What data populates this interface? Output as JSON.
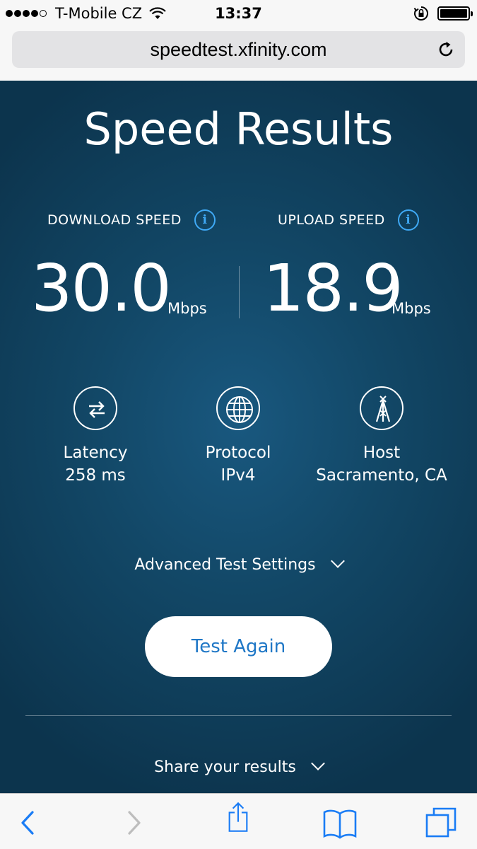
{
  "status_bar": {
    "carrier": "T-Mobile CZ",
    "time": "13:37",
    "signal_bars_filled": 4,
    "signal_bars_total": 5,
    "icons": [
      "wifi-icon",
      "orientation-lock-icon",
      "battery-icon"
    ]
  },
  "browser": {
    "url": "speedtest.xfinity.com",
    "reload_icon": "reload-icon"
  },
  "page": {
    "title": "Speed Results",
    "download": {
      "label": "DOWNLOAD SPEED",
      "value": "30.0",
      "unit": "Mbps",
      "info_glyph": "i"
    },
    "upload": {
      "label": "UPLOAD SPEED",
      "value": "18.9",
      "unit": "Mbps",
      "info_glyph": "i"
    },
    "metrics": [
      {
        "label": "Latency",
        "value": "258 ms",
        "icon": "arrows-exchange-icon"
      },
      {
        "label": "Protocol",
        "value": "IPv4",
        "icon": "globe-icon"
      },
      {
        "label": "Host",
        "value": "Sacramento, CA",
        "icon": "tower-icon"
      }
    ],
    "advanced_settings": "Advanced Test Settings",
    "test_again": "Test Again",
    "share_results": "Share your results"
  },
  "toolbar": {
    "icons": [
      "back-icon",
      "forward-icon",
      "share-icon",
      "bookmarks-icon",
      "tabs-icon"
    ]
  },
  "colors": {
    "accent_blue": "#3fa9f5",
    "button_text": "#1f77c6",
    "background_dark": "#0c344d",
    "ios_tint": "#1a7cf5"
  }
}
